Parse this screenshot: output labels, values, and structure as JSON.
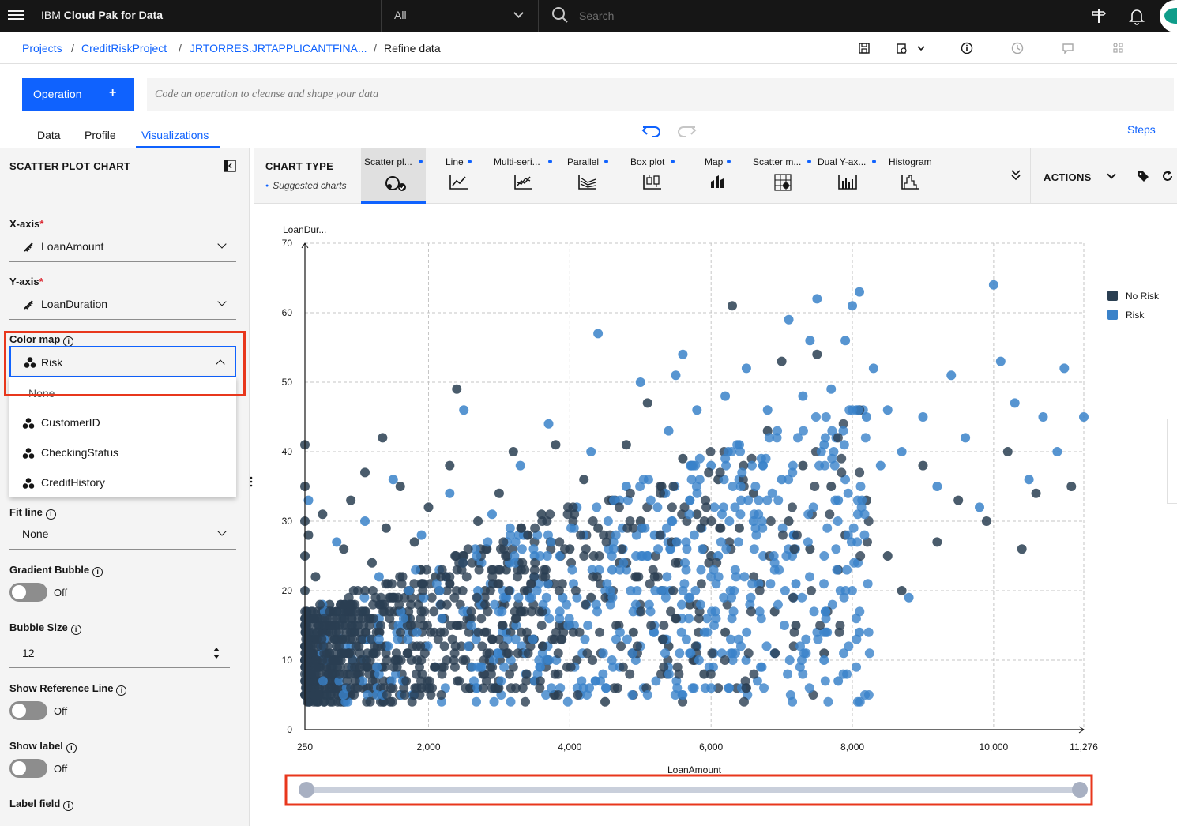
{
  "topbar": {
    "brand_prefix": "IBM",
    "brand_name": "Cloud Pak for Data",
    "scope_value": "All",
    "search_placeholder": "Search"
  },
  "breadcrumb": {
    "items": [
      "Projects",
      "CreditRiskProject",
      "JRTORRES.JRTAPPLICANTFINA..."
    ],
    "current": "Refine data"
  },
  "operation": {
    "button_label": "Operation",
    "button_plus": "+",
    "code_placeholder": "Code an operation to cleanse and shape your data"
  },
  "tabs": [
    {
      "label": "Data"
    },
    {
      "label": "Profile"
    },
    {
      "label": "Visualizations",
      "active": true
    }
  ],
  "steps_label": "Steps",
  "panel": {
    "title": "SCATTER PLOT CHART",
    "x_axis": {
      "label": "X-axis",
      "required": "*",
      "value": "LoanAmount"
    },
    "y_axis": {
      "label": "Y-axis",
      "required": "*",
      "value": "LoanDuration"
    },
    "color_map": {
      "label": "Color map",
      "value": "Risk",
      "options": [
        "None",
        "CustomerID",
        "CheckingStatus",
        "CreditHistory"
      ]
    },
    "fit_line": {
      "label": "Fit line",
      "value": "None"
    },
    "gradient_bubble": {
      "label": "Gradient Bubble",
      "state": "Off"
    },
    "bubble_size": {
      "label": "Bubble Size",
      "value": "12"
    },
    "reference_line": {
      "label": "Show Reference Line",
      "state": "Off"
    },
    "show_label": {
      "label": "Show label",
      "state": "Off"
    },
    "label_field": {
      "label": "Label field"
    }
  },
  "chart_types": {
    "title": "CHART TYPE",
    "subtitle": "Suggested charts",
    "items": [
      {
        "label": "Scatter pl...",
        "suggested": true,
        "icon": "scatter-icon",
        "active": true
      },
      {
        "label": "Line",
        "suggested": true,
        "icon": "line-chart-icon"
      },
      {
        "label": "Multi-seri...",
        "suggested": true,
        "icon": "multi-series-icon"
      },
      {
        "label": "Parallel",
        "suggested": true,
        "icon": "parallel-icon"
      },
      {
        "label": "Box plot",
        "suggested": true,
        "icon": "box-plot-icon"
      },
      {
        "label": "Map",
        "suggested": true,
        "icon": "map-icon"
      },
      {
        "label": "Scatter m...",
        "suggested": true,
        "icon": "scatter-matrix-icon"
      },
      {
        "label": "Dual Y-ax...",
        "suggested": true,
        "icon": "dual-y-axis-icon"
      },
      {
        "label": "Histogram",
        "suggested": false,
        "icon": "histogram-icon"
      }
    ],
    "actions_label": "ACTIONS"
  },
  "colors": {
    "accent": "#0f62fe",
    "no_risk": "#2a3f52",
    "risk": "#3a82c9",
    "highlight": "#e8371c"
  },
  "chart_data": {
    "type": "scatter",
    "xlabel": "LoanAmount",
    "ylabel": "LoanDur...",
    "xlim": [
      250,
      11276
    ],
    "ylim": [
      0,
      70
    ],
    "x_ticks": [
      250,
      2000,
      4000,
      6000,
      8000,
      10000,
      11276
    ],
    "x_tick_labels": [
      "250",
      "2,000",
      "4,000",
      "6,000",
      "8,000",
      "10,000",
      "11,276"
    ],
    "y_ticks": [
      0,
      10,
      20,
      30,
      40,
      50,
      60,
      70
    ],
    "y_tick_labels": [
      "0",
      "10",
      "20",
      "30",
      "40",
      "50",
      "60",
      "70"
    ],
    "grid": true,
    "legend_position": "right",
    "series": [
      {
        "name": "No Risk",
        "color": "#2a3f52",
        "points": [
          [
            250,
            41
          ],
          [
            250,
            35
          ],
          [
            250,
            30
          ],
          [
            250,
            25
          ],
          [
            250,
            20
          ],
          [
            250,
            15
          ],
          [
            250,
            10
          ],
          [
            250,
            5
          ],
          [
            300,
            28
          ],
          [
            400,
            22
          ],
          [
            500,
            31
          ],
          [
            600,
            18
          ],
          [
            700,
            12
          ],
          [
            800,
            26
          ],
          [
            900,
            33
          ],
          [
            1000,
            8
          ],
          [
            1100,
            37
          ],
          [
            1200,
            24
          ],
          [
            1300,
            14
          ],
          [
            1350,
            42
          ],
          [
            1400,
            29
          ],
          [
            1500,
            19
          ],
          [
            1600,
            35
          ],
          [
            1700,
            11
          ],
          [
            1800,
            27
          ],
          [
            1900,
            6
          ],
          [
            2000,
            32
          ],
          [
            2100,
            22
          ],
          [
            2200,
            16
          ],
          [
            2300,
            38
          ],
          [
            2400,
            49
          ],
          [
            2500,
            25
          ],
          [
            2600,
            9
          ],
          [
            2700,
            30
          ],
          [
            2800,
            20
          ],
          [
            2900,
            13
          ],
          [
            3000,
            34
          ],
          [
            3100,
            23
          ],
          [
            3200,
            40
          ],
          [
            3300,
            17
          ],
          [
            3400,
            28
          ],
          [
            3500,
            7
          ],
          [
            3600,
            31
          ],
          [
            3700,
            21
          ],
          [
            3800,
            41
          ],
          [
            3900,
            15
          ],
          [
            4000,
            26
          ],
          [
            4100,
            10
          ],
          [
            4200,
            36
          ],
          [
            4300,
            19
          ],
          [
            4400,
            29
          ],
          [
            4500,
            4
          ],
          [
            4600,
            33
          ],
          [
            4700,
            24
          ],
          [
            4800,
            41
          ],
          [
            4900,
            14
          ],
          [
            5000,
            30
          ],
          [
            5100,
            47
          ],
          [
            5200,
            22
          ],
          [
            5300,
            35
          ],
          [
            5400,
            12
          ],
          [
            5500,
            27
          ],
          [
            5600,
            39
          ],
          [
            5700,
            18
          ],
          [
            5800,
            31
          ],
          [
            5900,
            8
          ],
          [
            6000,
            25
          ],
          [
            6100,
            36
          ],
          [
            6200,
            14
          ],
          [
            6300,
            61
          ],
          [
            6400,
            29
          ],
          [
            6500,
            6
          ],
          [
            6600,
            34
          ],
          [
            6700,
            21
          ],
          [
            6800,
            43
          ],
          [
            6900,
            17
          ],
          [
            7000,
            53
          ],
          [
            7100,
            30
          ],
          [
            7200,
            15
          ],
          [
            7300,
            38
          ],
          [
            7400,
            26
          ],
          [
            7500,
            54
          ],
          [
            7600,
            11
          ],
          [
            7700,
            35
          ],
          [
            7800,
            23
          ],
          [
            7900,
            28
          ],
          [
            8200,
            33
          ],
          [
            8500,
            25
          ],
          [
            8700,
            20
          ],
          [
            9000,
            38
          ],
          [
            9200,
            27
          ],
          [
            9500,
            33
          ],
          [
            9900,
            30
          ],
          [
            10200,
            40
          ],
          [
            10400,
            26
          ],
          [
            10600,
            34
          ],
          [
            11100,
            35
          ]
        ]
      },
      {
        "name": "Risk",
        "color": "#3a82c9",
        "points": [
          [
            300,
            33
          ],
          [
            500,
            18
          ],
          [
            700,
            27
          ],
          [
            900,
            12
          ],
          [
            1100,
            30
          ],
          [
            1300,
            22
          ],
          [
            1500,
            36
          ],
          [
            1700,
            16
          ],
          [
            1900,
            28
          ],
          [
            2100,
            9
          ],
          [
            2300,
            34
          ],
          [
            2500,
            46
          ],
          [
            2700,
            20
          ],
          [
            2900,
            31
          ],
          [
            3100,
            14
          ],
          [
            3300,
            38
          ],
          [
            3500,
            25
          ],
          [
            3700,
            44
          ],
          [
            3900,
            19
          ],
          [
            4100,
            32
          ],
          [
            4300,
            40
          ],
          [
            4400,
            57
          ],
          [
            4600,
            23
          ],
          [
            4800,
            35
          ],
          [
            5000,
            50
          ],
          [
            5200,
            28
          ],
          [
            5400,
            43
          ],
          [
            5500,
            51
          ],
          [
            5600,
            54
          ],
          [
            5700,
            33
          ],
          [
            5800,
            46
          ],
          [
            6000,
            38
          ],
          [
            6100,
            25
          ],
          [
            6200,
            48
          ],
          [
            6400,
            41
          ],
          [
            6500,
            52
          ],
          [
            6600,
            30
          ],
          [
            6800,
            46
          ],
          [
            7000,
            36
          ],
          [
            7100,
            59
          ],
          [
            7200,
            21
          ],
          [
            7300,
            48
          ],
          [
            7400,
            56
          ],
          [
            7500,
            62
          ],
          [
            7600,
            41
          ],
          [
            7700,
            49
          ],
          [
            7800,
            33
          ],
          [
            7900,
            56
          ],
          [
            8000,
            61
          ],
          [
            8100,
            63
          ],
          [
            8200,
            45
          ],
          [
            8300,
            52
          ],
          [
            8400,
            38
          ],
          [
            8500,
            46
          ],
          [
            8700,
            40
          ],
          [
            8800,
            19
          ],
          [
            9000,
            45
          ],
          [
            9200,
            35
          ],
          [
            9400,
            51
          ],
          [
            9600,
            42
          ],
          [
            9800,
            32
          ],
          [
            10000,
            64
          ],
          [
            10100,
            53
          ],
          [
            10300,
            47
          ],
          [
            10500,
            36
          ],
          [
            10700,
            45
          ],
          [
            10900,
            40
          ],
          [
            11000,
            52
          ],
          [
            11276,
            45
          ],
          [
            8100,
            14
          ],
          [
            7800,
            7
          ],
          [
            7600,
            10
          ],
          [
            6900,
            11
          ],
          [
            5800,
            12
          ]
        ]
      }
    ]
  }
}
